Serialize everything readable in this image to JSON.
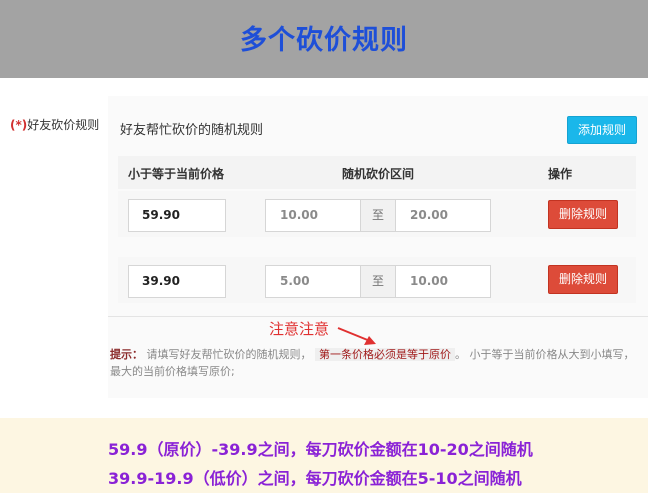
{
  "banner": {
    "title": "多个砍价规则"
  },
  "field": {
    "required_mark": "(*)",
    "label": "好友砍价规则"
  },
  "section": {
    "title": "好友帮忙砍价的随机规则",
    "add_button": "添加规则"
  },
  "table": {
    "headers": [
      "小于等于当前价格",
      "随机砍价区间",
      "操作"
    ],
    "range_separator": "至",
    "rows": [
      {
        "price": "59.90",
        "min": "10.00",
        "max": "20.00",
        "action": "删除规则"
      },
      {
        "price": "39.90",
        "min": "5.00",
        "max": "10.00",
        "action": "删除规则"
      }
    ]
  },
  "annotation": {
    "label": "注意注意"
  },
  "tip": {
    "title": "提示：",
    "part1": "请填写好友帮忙砍价的随机规则，",
    "highlight": "第一条价格必须是等于原价",
    "part2": "。 小于等于当前价格从大到小填写，最大的当前价格填写原价;"
  },
  "summary": {
    "lines": [
      "59.9（原价）-39.9之间，每刀砍价金额在10-20之间随机",
      "39.9-19.9（低价）之间，每刀砍价金额在5-10之间随机"
    ]
  },
  "colors": {
    "banner_bg": "#a3a3a3",
    "title": "#1e4fd8",
    "add_button": "#1ab7ea",
    "delete_button": "#dd4b39",
    "summary_text": "#8a22d6",
    "summary_bg": "#fdf6e2"
  }
}
